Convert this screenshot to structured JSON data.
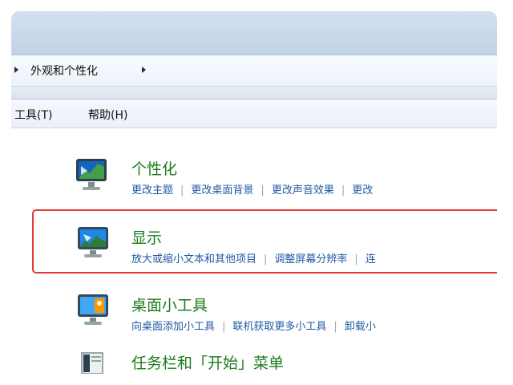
{
  "breadcrumb": {
    "label": "外观和个性化"
  },
  "menu": {
    "tools": "工具(T)",
    "help": "帮助(H)"
  },
  "categories": [
    {
      "title": "个性化",
      "icon": "personalization-monitor-icon",
      "links": [
        "更改主题",
        "更改桌面背景",
        "更改声音效果",
        "更改"
      ]
    },
    {
      "title": "显示",
      "icon": "display-monitor-icon",
      "links": [
        "放大或缩小文本和其他项目",
        "调整屏幕分辨率",
        "连"
      ]
    },
    {
      "title": "桌面小工具",
      "icon": "desktop-gadgets-icon",
      "links": [
        "向桌面添加小工具",
        "联机获取更多小工具",
        "卸载小"
      ]
    },
    {
      "title": "任务栏和「开始」菜单",
      "icon": "taskbar-start-menu-icon",
      "links": []
    }
  ],
  "colors": {
    "category_title": "#1e7a1e",
    "link": "#1f5aa6",
    "highlight_border": "#e53935"
  }
}
